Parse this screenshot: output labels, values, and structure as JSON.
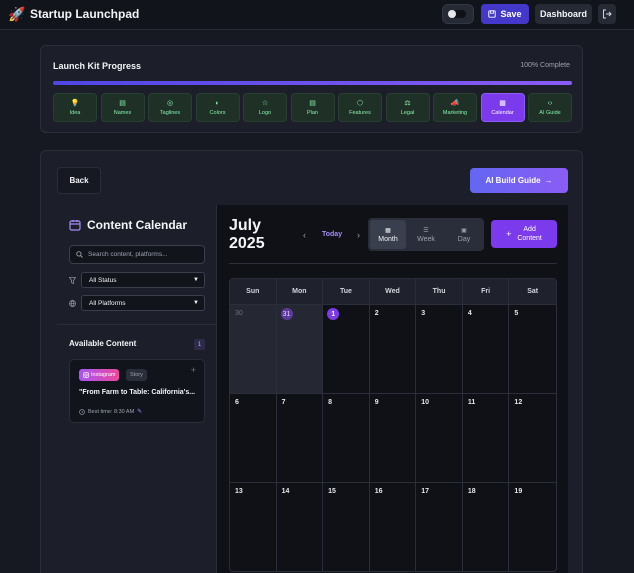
{
  "header": {
    "brand_icon": "rocket-icon",
    "title": "Startup Launchpad",
    "save_label": "Save",
    "dashboard_label": "Dashboard"
  },
  "progress": {
    "title": "Launch Kit Progress",
    "complete_text": "100% Complete",
    "percent": 100,
    "steps": [
      {
        "label": "Idea",
        "icon": "bulb-icon",
        "glyph": "💡"
      },
      {
        "label": "Names",
        "icon": "document-icon",
        "glyph": "▤"
      },
      {
        "label": "Taglines",
        "icon": "target-icon",
        "glyph": "◎"
      },
      {
        "label": "Colors",
        "icon": "palette-icon",
        "glyph": "◐"
      },
      {
        "label": "Logo",
        "icon": "star-icon",
        "glyph": "☆"
      },
      {
        "label": "Plan",
        "icon": "file-icon",
        "glyph": "▤"
      },
      {
        "label": "Features",
        "icon": "box-icon",
        "glyph": "⬡"
      },
      {
        "label": "Legal",
        "icon": "scale-icon",
        "glyph": "⚖"
      },
      {
        "label": "Marketing",
        "icon": "megaphone-icon",
        "glyph": "📣"
      },
      {
        "label": "Calendar",
        "icon": "calendar-icon",
        "glyph": "▦"
      },
      {
        "label": "AI Guide",
        "icon": "code-icon",
        "glyph": "‹›"
      }
    ],
    "active_step": "Calendar"
  },
  "main": {
    "back_label": "Back",
    "ai_guide_label": "AI Build Guide"
  },
  "sidebar": {
    "title": "Content Calendar",
    "search_placeholder": "Search content, platforms...",
    "status_filter": "All Status",
    "platform_filter": "All Platforms",
    "available_title": "Available Content",
    "available_count": "1",
    "card": {
      "platform": "Instagram",
      "type": "Story",
      "title": "\"From Farm to Table: California's...",
      "best_time": "Best time: 8:30 AM"
    }
  },
  "calendar": {
    "month": "July",
    "year": "2025",
    "today_label": "Today",
    "views": [
      "Month",
      "Week",
      "Day"
    ],
    "active_view": "Month",
    "add_label_1": "Add",
    "add_label_2": "Content",
    "weekdays": [
      "Sun",
      "Mon",
      "Tue",
      "Wed",
      "Thu",
      "Fri",
      "Sat"
    ],
    "weeks": [
      [
        "30",
        "31",
        "1",
        "2",
        "3",
        "4",
        "5"
      ],
      [
        "6",
        "7",
        "8",
        "9",
        "10",
        "11",
        "12"
      ],
      [
        "13",
        "14",
        "15",
        "16",
        "17",
        "18",
        "19"
      ]
    ],
    "today": "1"
  },
  "colors": {
    "accent": "#7c3aed",
    "step_done": "#86efac",
    "background": "#161922"
  }
}
